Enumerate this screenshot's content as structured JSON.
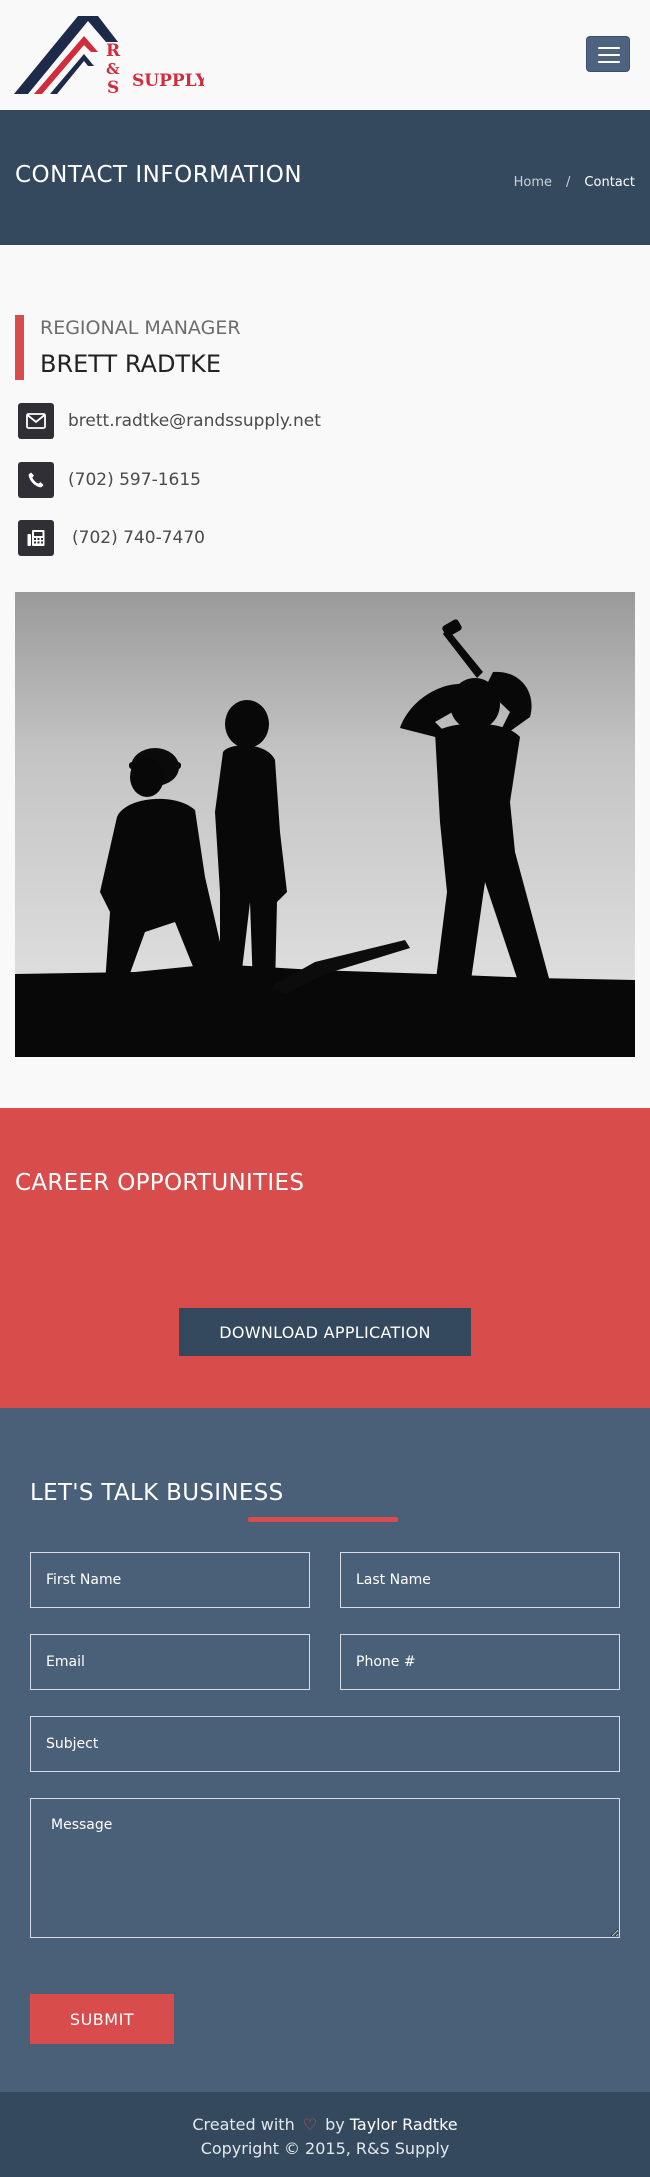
{
  "header": {
    "logo_text": "R&S SUPPLY",
    "menu_button_label": "Toggle navigation"
  },
  "title_band": {
    "title": "CONTACT INFORMATION",
    "breadcrumb": {
      "home": "Home",
      "separator": "/",
      "current": "Contact"
    }
  },
  "contact": {
    "role": "REGIONAL MANAGER",
    "name": "BRETT RADTKE",
    "email": "brett.radtke@randssupply.net",
    "phone": "(702) 597-1615",
    "fax": "(702) 740-7470",
    "icons": [
      "envelope-icon",
      "phone-icon",
      "fax-icon"
    ]
  },
  "careers": {
    "title": "CAREER OPPORTUNITIES",
    "download_label": "DOWNLOAD APPLICATION"
  },
  "form": {
    "title": "LET'S TALK BUSINESS",
    "first_name_placeholder": "First Name",
    "last_name_placeholder": "Last Name",
    "email_placeholder": "Email",
    "phone_placeholder": "Phone #",
    "subject_placeholder": "Subject",
    "message_placeholder": "Message",
    "submit_label": "SUBMIT"
  },
  "footer": {
    "created_with": "Created with",
    "by": "by",
    "author": "Taylor Radtke",
    "copyright": "Copyright © 2015, R&S Supply"
  },
  "colors": {
    "navy": "#34495e",
    "slate": "#4a6078",
    "accent_red": "#d94c4c",
    "background": "#f9f9f9"
  }
}
